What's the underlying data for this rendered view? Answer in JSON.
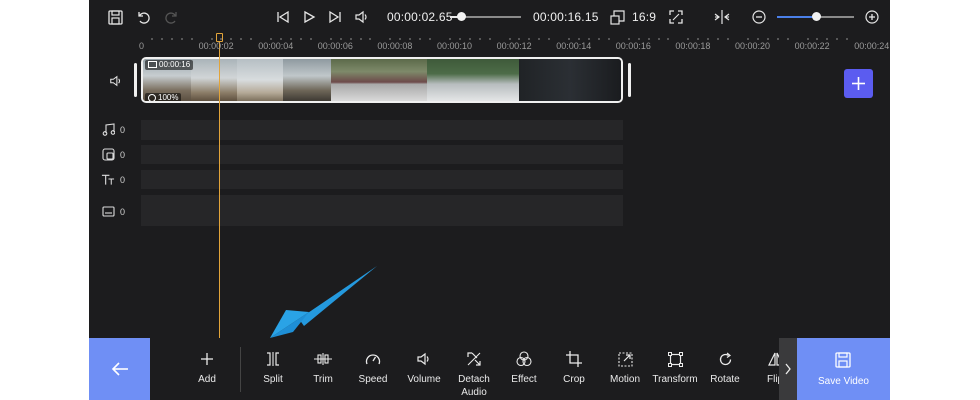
{
  "topbar": {
    "current_time": "00:00:02.65",
    "total_time": "00:00:16.15",
    "aspect_ratio": "16:9",
    "playback_progress": 0.16,
    "zoom_level": 0.5
  },
  "ruler": {
    "labels": [
      "0",
      "00:00:02",
      "00:00:04",
      "00:00:06",
      "00:00:08",
      "00:00:10",
      "00:00:12",
      "00:00:14",
      "00:00:16",
      "00:00:18",
      "00:00:20",
      "00:00:22",
      "00:00:24"
    ]
  },
  "clip": {
    "duration": "00:00:16",
    "volume": "100%"
  },
  "tracks": {
    "music_count": "0",
    "overlay_count": "0",
    "text_count": "0",
    "subtitle_count": "0"
  },
  "toolbar": {
    "add": "Add",
    "split": "Split",
    "trim": "Trim",
    "speed": "Speed",
    "volume": "Volume",
    "detach_audio": "Detach Audio",
    "effect": "Effect",
    "crop": "Crop",
    "motion": "Motion",
    "transform": "Transform",
    "rotate": "Rotate",
    "flip": "Flip",
    "save_video": "Save Video"
  },
  "colors": {
    "accent": "#6f8ff5",
    "playhead": "#e2a43a",
    "add_track": "#5b5cf0",
    "annotation_arrow": "#2aa3e6"
  }
}
